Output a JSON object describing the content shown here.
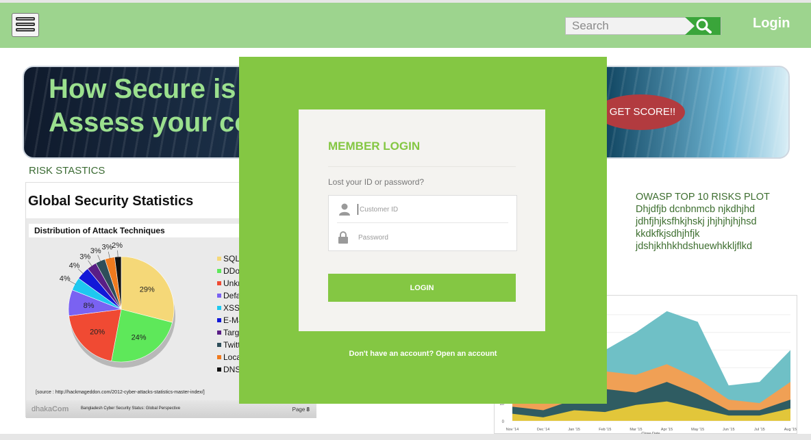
{
  "header": {
    "search_placeholder": "Search",
    "login_label": "Login"
  },
  "banner": {
    "title": "How Secure is y\nAssess your co",
    "score_button": "GET SCORE!!"
  },
  "risk_label": "RISK STASTICS",
  "slide": {
    "title": "Global Security Statistics",
    "subtitle": "Distribution of Attack Techniques",
    "source": "[source : http://hackmageddon.com/2012-cyber-attacks-statistics-master-index/]",
    "brand_prefix": "dhaka",
    "brand_suffix": "Com",
    "footer_text": "Bangladesh Cyber Security Status: Global Perspective",
    "page_label": "Page",
    "page_number": "8"
  },
  "chart_data": [
    {
      "type": "pie",
      "title": "Distribution of Attack Techniques",
      "slices": [
        {
          "label": "SQL",
          "value": 29,
          "color": "#f5d878"
        },
        {
          "label": "DDo",
          "value": 24,
          "color": "#5ee85a"
        },
        {
          "label": "Unkr",
          "value": 20,
          "color": "#f04a33"
        },
        {
          "label": "Defa",
          "value": 8,
          "color": "#7a62f2"
        },
        {
          "label": "XSS",
          "value": 4,
          "color": "#1ec8f0"
        },
        {
          "label": "E-Ma",
          "value": 4,
          "color": "#1218d8"
        },
        {
          "label": "Targe",
          "value": 3,
          "color": "#5a1e86"
        },
        {
          "label": "Twitt",
          "value": 3,
          "color": "#2e4e5a"
        },
        {
          "label": "Loca",
          "value": 3,
          "color": "#f07a1e"
        },
        {
          "label": "DNS",
          "value": 2,
          "color": "#111111"
        }
      ]
    },
    {
      "type": "area",
      "x": [
        "Nov '14",
        "Dec '14",
        "Jan '15",
        "Feb '15",
        "Mar '15",
        "Apr '15",
        "May '15",
        "Jun '15",
        "Jul '15",
        "Aug '15"
      ],
      "xlabel": "Close Date",
      "y_ticks": [
        "0",
        "10"
      ],
      "series": [
        {
          "color": "#e2c63a",
          "values": [
            4,
            2,
            6,
            5,
            9,
            11,
            7,
            3,
            3,
            7
          ]
        },
        {
          "color": "#2f5c62",
          "values": [
            8,
            6,
            12,
            18,
            16,
            22,
            15,
            6,
            6,
            12
          ]
        },
        {
          "color": "#f0a055",
          "values": [
            12,
            10,
            20,
            28,
            26,
            32,
            24,
            12,
            10,
            22
          ]
        },
        {
          "color": "#6fc0c6",
          "values": [
            14,
            14,
            26,
            40,
            50,
            62,
            56,
            20,
            22,
            40
          ]
        }
      ]
    }
  ],
  "owasp": {
    "heading": "OWASP TOP 10 RISKS PLOT",
    "body": "Dhjdfjb dcnbnmcb njkdhjhd jdhfjhjksfhkjhskj jhjhjhjhjhsd kkdkfkjsdhjhfjk jdshjkhhkhdshuewhkkljflkd"
  },
  "login_modal": {
    "title": "MEMBER LOGIN",
    "lost_link": "Lost your ID or password?",
    "customer_id_placeholder": "Customer ID",
    "password_placeholder": "Password",
    "login_button": "LOGIN",
    "signup_text": "Don't have an account? Open an account"
  }
}
